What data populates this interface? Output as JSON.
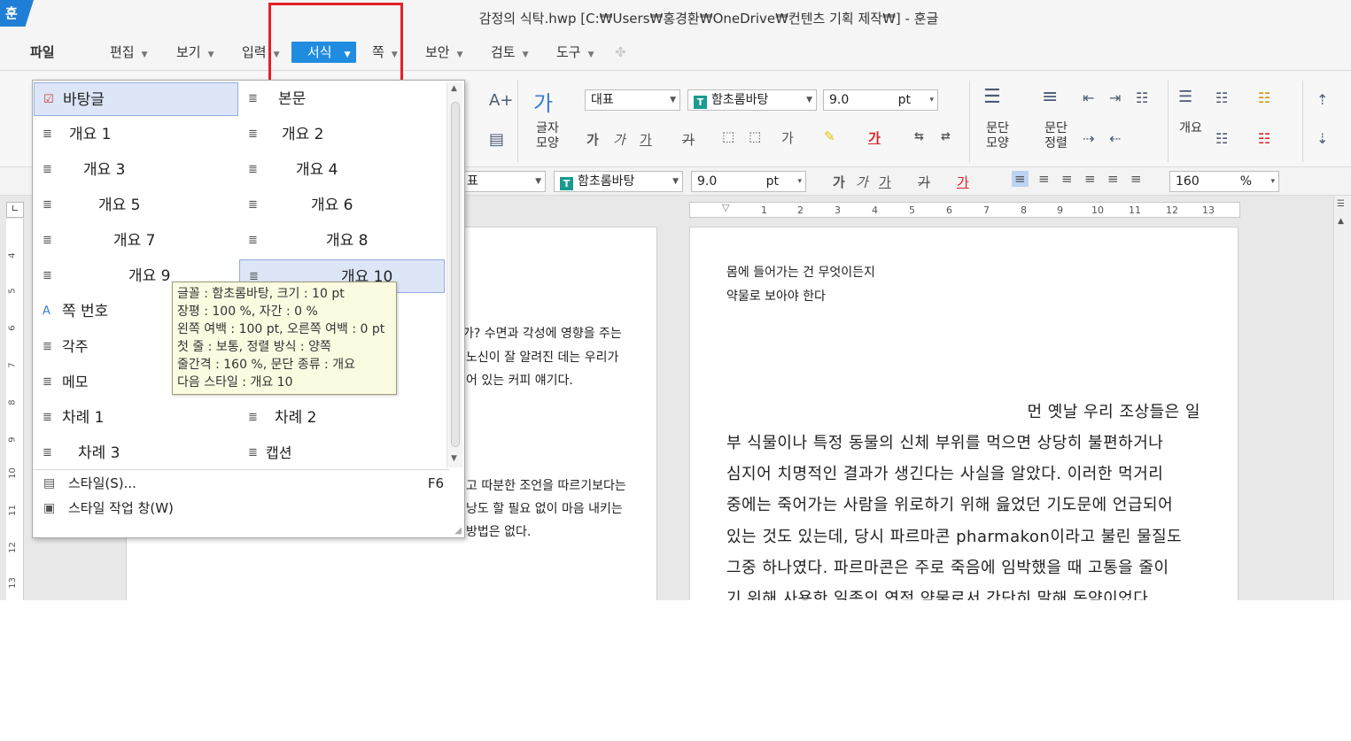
{
  "window": {
    "app_logo": "훈",
    "title": "감정의 식탁.hwp [C:₩Users₩홍경환₩OneDrive₩컨텐츠 기획 제작₩] - 훈글"
  },
  "menu": {
    "file": "파일",
    "edit": "편집",
    "view": "보기",
    "input": "입력",
    "format": "서식",
    "page": "쪽",
    "security": "보안",
    "review": "검토",
    "tools": "도구"
  },
  "ribbon": {
    "char_shape": [
      "글자",
      "모양"
    ],
    "para_shape": [
      "문단",
      "모양"
    ],
    "para_align": [
      "문단",
      "정렬"
    ],
    "outline": "개요",
    "style_combo": "대표",
    "font_combo": "함초롬바탕",
    "size_value": "9.0",
    "size_unit": "pt",
    "char_hanja": "가"
  },
  "toolbar2": {
    "style_partial": "표",
    "font_combo": "함초롬바탕",
    "size_value": "9.0",
    "size_unit": "pt",
    "zoom_value": "160",
    "zoom_unit": "%"
  },
  "ruler": {
    "h_numbers": [
      "1",
      "2",
      "3",
      "4",
      "5",
      "6",
      "7",
      "8",
      "9",
      "10",
      "11",
      "12",
      "13"
    ],
    "v_numbers": [
      "4",
      "5",
      "6",
      "7",
      "8",
      "9",
      "10",
      "11",
      "12",
      "13"
    ]
  },
  "left_page": {
    "lines": [
      "가? 수면과 각성에 영향을 주는",
      "노신이 잘 알려진 데는 우리가",
      "어 있는 커피 얘기다.",
      "고 따분한 조언을 따르기보다는",
      "낭도 할 필요 없이 마음 내키는",
      "방법은 없다."
    ]
  },
  "right_page": {
    "head_lines": [
      "몸에 들어가는 건 무엇이든지",
      "약물로 보아야 한다"
    ],
    "body_lines": [
      "먼 옛날 우리 조상들은 일",
      "부 식물이나 특정 동물의 신체 부위를 먹으면 상당히 불편하거나",
      "심지어 치명적인 결과가 생긴다는 사실을 알았다. 이러한 먹거리",
      "중에는 죽어가는 사람을 위로하기 위해 읊었던 기도문에 언급되어",
      "있는 것도 있는데, 당시 파르마콘 pharmakon이라고 불린 물질도",
      "그중 하나였다. 파르마콘은 주로 죽음에 임박했을 때 고통을 줄이",
      "기 위해 사용한 일종의 연적 약물로서 간단히 말해 독약이었다"
    ]
  },
  "style_dropdown": {
    "items": [
      {
        "label": "바탕글"
      },
      {
        "label": "본문"
      },
      {
        "label": "개요 1"
      },
      {
        "label": "개요 2"
      },
      {
        "label": "개요 3"
      },
      {
        "label": "개요 4"
      },
      {
        "label": "개요 5"
      },
      {
        "label": "개요 6"
      },
      {
        "label": "개요 7"
      },
      {
        "label": "개요 8"
      },
      {
        "label": "개요 9"
      },
      {
        "label": "개요 10"
      },
      {
        "label": "쪽 번호"
      },
      {
        "label": "각주"
      },
      {
        "label": "메모"
      },
      {
        "label": "차례 1"
      },
      {
        "label": "차례 2"
      },
      {
        "label": "차례 3"
      },
      {
        "label": "캡션"
      }
    ],
    "footer": {
      "style_label": "스타일(S)...",
      "style_key": "F6",
      "style_window_label": "스타일 작업 창(W)"
    }
  },
  "tooltip": {
    "lines": [
      "글꼴 : 함초롬바탕,  크기 : 10 pt",
      "장평 : 100 %,  자간 : 0 %",
      "왼쪽 여백 : 100 pt,  오른쪽 여백 : 0 pt",
      "첫 줄 : 보통,  정렬 방식 : 양쪽",
      "줄간격 : 160 %,  문단 종류 : 개요",
      "다음 스타일 : 개요 10"
    ]
  },
  "colors": {
    "accent": "#1f8ce0",
    "highlight_box": "#e32027",
    "selected_item_bg": "#dce6f7",
    "tooltip_bg": "#fbfbe2"
  }
}
